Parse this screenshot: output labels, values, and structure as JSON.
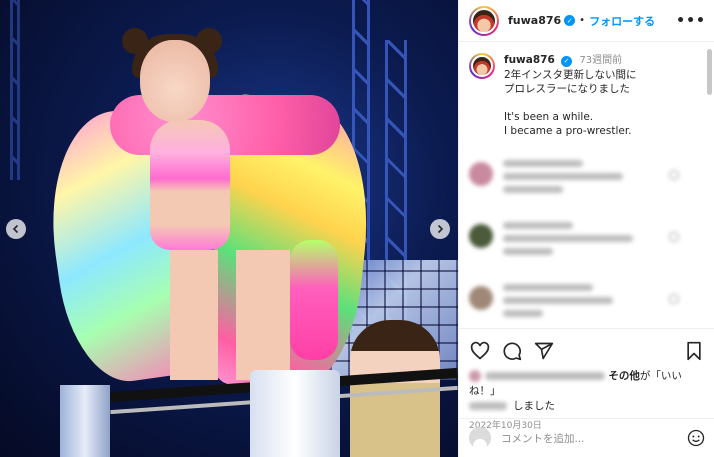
{
  "post": {
    "username": "fuwa876",
    "follow_label": "フォローする",
    "separator": "•",
    "more_label": "•••"
  },
  "caption": {
    "username": "fuwa876",
    "time_ago": "73週間前",
    "lines_ja": [
      "2年インスタ更新しない間に",
      "プロレスラーになりました"
    ],
    "lines_en": [
      "It's been a while.",
      "I became a pro-wrestler."
    ]
  },
  "likes": {
    "others_prefix": "その他",
    "others_suffix": "が「いいね！」",
    "second_line": "しました"
  },
  "date": "2022年10月30日",
  "add_comment": {
    "placeholder": "コメントを追加..."
  },
  "colors": {
    "accent": "#0095f6",
    "text": "#262626",
    "muted": "#8e8e8e",
    "border": "#efefef"
  },
  "icons": {
    "like": "heart-icon",
    "comment": "comment-icon",
    "share": "paper-plane-icon",
    "save": "bookmark-icon",
    "emoji": "smiley-icon",
    "prev": "chevron-left-icon",
    "next": "chevron-right-icon"
  }
}
